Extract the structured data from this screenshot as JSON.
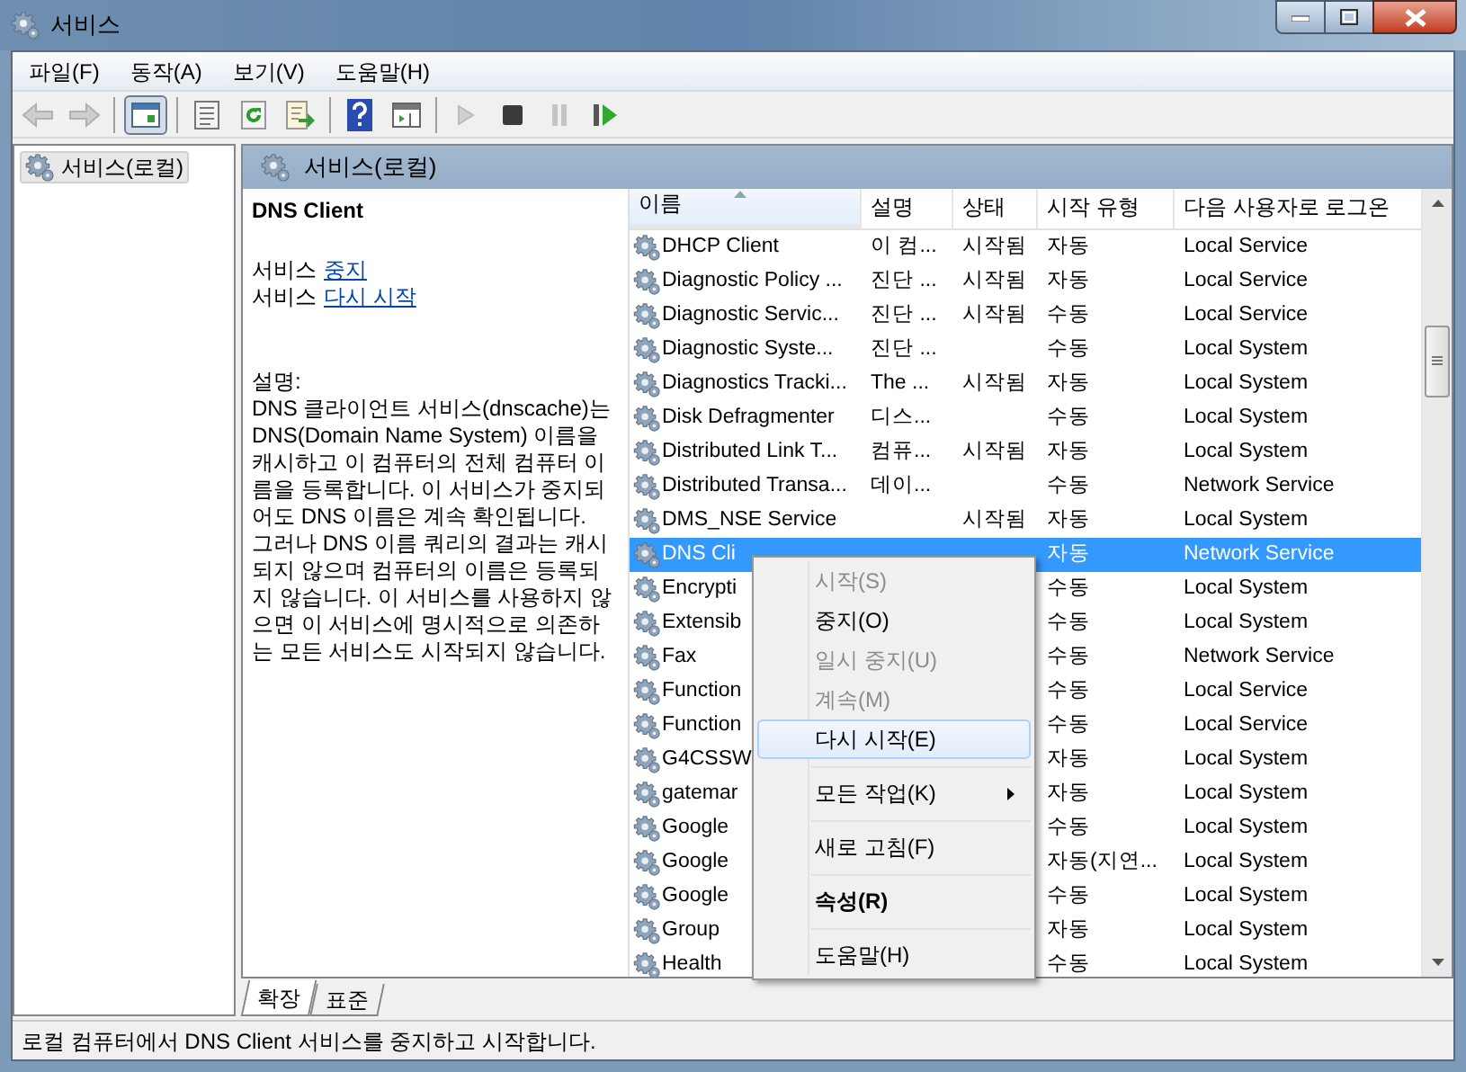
{
  "window": {
    "title": "서비스"
  },
  "menu_bar": [
    "파일(F)",
    "동작(A)",
    "보기(V)",
    "도움말(H)"
  ],
  "toolbar": [
    {
      "kind": "back",
      "disabled": true,
      "pressed": false
    },
    {
      "kind": "forward",
      "disabled": true,
      "pressed": false
    },
    {
      "kind": "separator"
    },
    {
      "kind": "tree",
      "disabled": false,
      "pressed": true
    },
    {
      "kind": "separator"
    },
    {
      "kind": "properties",
      "disabled": false,
      "pressed": false
    },
    {
      "kind": "refresh",
      "disabled": false,
      "pressed": false
    },
    {
      "kind": "export",
      "disabled": false,
      "pressed": false
    },
    {
      "kind": "separator"
    },
    {
      "kind": "help",
      "disabled": false,
      "pressed": false
    },
    {
      "kind": "view",
      "disabled": false,
      "pressed": false
    },
    {
      "kind": "separator"
    },
    {
      "kind": "play",
      "disabled": true,
      "pressed": false
    },
    {
      "kind": "stop",
      "disabled": false,
      "pressed": false
    },
    {
      "kind": "pause",
      "disabled": true,
      "pressed": false
    },
    {
      "kind": "restart",
      "disabled": false,
      "pressed": false
    }
  ],
  "tree": {
    "items": [
      {
        "label": "서비스(로컬)",
        "selected": true
      }
    ]
  },
  "panel": {
    "title": "서비스(로컬)"
  },
  "details": {
    "service_name": "DNS Client",
    "actions": [
      {
        "prefix": "서비스",
        "link": "중지"
      },
      {
        "prefix": "서비스",
        "link": "다시 시작"
      }
    ],
    "description_label": "설명:",
    "description": "DNS 클라이언트 서비스(dnscache)는 DNS(Domain Name System) 이름을 캐시하고 이 컴퓨터의 전체 컴퓨터 이름을 등록합니다. 이 서비스가 중지되어도 DNS 이름은 계속 확인됩니다. 그러나 DNS 이름 쿼리의 결과는 캐시되지 않으며 컴퓨터의 이름은 등록되지 않습니다. 이 서비스를 사용하지 않으면 이 서비스에 명시적으로 의존하는 모든 서비스도 시작되지 않습니다."
  },
  "table": {
    "columns": [
      {
        "label": "이름",
        "sorted": true
      },
      {
        "label": "설명",
        "sorted": false
      },
      {
        "label": "상태",
        "sorted": false
      },
      {
        "label": "시작 유형",
        "sorted": false
      },
      {
        "label": "다음 사용자로 로그온",
        "sorted": false
      }
    ],
    "rows": [
      {
        "name": "DHCP Client",
        "description": "이 컴...",
        "status": "시작됨",
        "startup": "자동",
        "logon": "Local Service",
        "selected": false
      },
      {
        "name": "Diagnostic Policy ...",
        "description": "진단 ...",
        "status": "시작됨",
        "startup": "자동",
        "logon": "Local Service",
        "selected": false
      },
      {
        "name": "Diagnostic Servic...",
        "description": "진단 ...",
        "status": "시작됨",
        "startup": "수동",
        "logon": "Local Service",
        "selected": false
      },
      {
        "name": "Diagnostic Syste...",
        "description": "진단 ...",
        "startup": "수동",
        "logon": "Local System",
        "selected": false
      },
      {
        "name": "Diagnostics Tracki...",
        "description": "The ...",
        "status": "시작됨",
        "startup": "자동",
        "logon": "Local System",
        "selected": false
      },
      {
        "name": "Disk Defragmenter",
        "description": "디스...",
        "startup": "수동",
        "logon": "Local System",
        "selected": false
      },
      {
        "name": "Distributed Link T...",
        "description": "컴퓨...",
        "status": "시작됨",
        "startup": "자동",
        "logon": "Local System",
        "selected": false
      },
      {
        "name": "Distributed Transa...",
        "description": "데이...",
        "startup": "수동",
        "logon": "Network Service",
        "selected": false
      },
      {
        "name": "DMS_NSE Service",
        "status": "시작됨",
        "startup": "자동",
        "logon": "Local System",
        "selected": false
      },
      {
        "name": "DNS Cli",
        "startup": "자동",
        "logon": "Network Service",
        "selected": true
      },
      {
        "name": "Encrypti",
        "startup": "수동",
        "logon": "Local System",
        "selected": false
      },
      {
        "name": "Extensib",
        "startup": "수동",
        "logon": "Local System",
        "selected": false
      },
      {
        "name": "Fax",
        "startup": "수동",
        "logon": "Network Service",
        "selected": false
      },
      {
        "name": "Function",
        "startup": "수동",
        "logon": "Local Service",
        "selected": false
      },
      {
        "name": "Function",
        "startup": "수동",
        "logon": "Local Service",
        "selected": false
      },
      {
        "name": "G4CSSW",
        "startup": "자동",
        "logon": "Local System",
        "selected": false
      },
      {
        "name": "gatemar",
        "startup": "자동",
        "logon": "Local System",
        "selected": false
      },
      {
        "name": "Google",
        "startup": "수동",
        "logon": "Local System",
        "selected": false
      },
      {
        "name": "Google",
        "startup": "자동(지연...",
        "logon": "Local System",
        "selected": false
      },
      {
        "name": "Google",
        "startup": "수동",
        "logon": "Local System",
        "selected": false
      },
      {
        "name": "Group",
        "startup": "자동",
        "logon": "Local System",
        "selected": false
      },
      {
        "name": "Health",
        "startup": "수동",
        "logon": "Local System",
        "selected": false
      }
    ]
  },
  "context_menu": [
    {
      "kind": "item",
      "label": "시작(S)",
      "disabled": true,
      "selected": false,
      "bold": false,
      "submenu": false
    },
    {
      "kind": "item",
      "label": "중지(O)",
      "disabled": false,
      "selected": false,
      "bold": false,
      "submenu": false
    },
    {
      "kind": "item",
      "label": "일시 중지(U)",
      "disabled": true,
      "selected": false,
      "bold": false,
      "submenu": false
    },
    {
      "kind": "item",
      "label": "계속(M)",
      "disabled": true,
      "selected": false,
      "bold": false,
      "submenu": false
    },
    {
      "kind": "item",
      "label": "다시 시작(E)",
      "disabled": false,
      "selected": true,
      "bold": false,
      "submenu": false
    },
    {
      "kind": "separator"
    },
    {
      "kind": "item",
      "label": "모든 작업(K)",
      "disabled": false,
      "selected": false,
      "bold": false,
      "submenu": true
    },
    {
      "kind": "separator"
    },
    {
      "kind": "item",
      "label": "새로 고침(F)",
      "disabled": false,
      "selected": false,
      "bold": false,
      "submenu": false
    },
    {
      "kind": "separator"
    },
    {
      "kind": "item",
      "label": "속성(R)",
      "disabled": false,
      "selected": false,
      "bold": true,
      "submenu": false
    },
    {
      "kind": "separator"
    },
    {
      "kind": "item",
      "label": "도움말(H)",
      "disabled": false,
      "selected": false,
      "bold": false,
      "submenu": false
    }
  ],
  "view_tabs": [
    {
      "label": "확장",
      "selected": true
    },
    {
      "label": "표준",
      "selected": false
    }
  ],
  "status_bar": "로컬 컴퓨터에서 DNS Client 서비스를 중지하고 시작합니다."
}
